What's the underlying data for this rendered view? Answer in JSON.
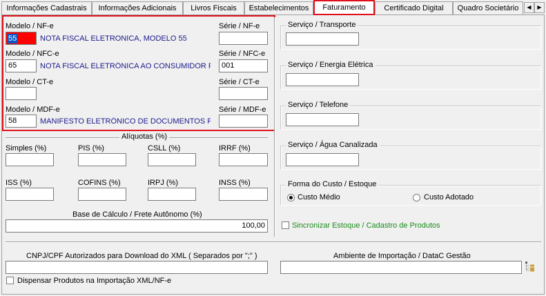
{
  "tabs": [
    {
      "label": "Informações Cadastrais"
    },
    {
      "label": "Informações Adicionais"
    },
    {
      "label": "Livros Fiscais"
    },
    {
      "label": "Estabelecimentos"
    },
    {
      "label": "Faturamento"
    },
    {
      "label": "Certificado Digital"
    },
    {
      "label": "Quadro Societário"
    }
  ],
  "tab_scroll": {
    "left": "◀",
    "right": "▶"
  },
  "modelos": {
    "nfe": {
      "label": "Modelo / NF-e",
      "value": "55",
      "description": "NOTA FISCAL ELETRONICA, MODELO 55",
      "serie_label": "Série / NF-e",
      "serie_value": ""
    },
    "nfce": {
      "label": "Modelo / NFC-e",
      "value": "65",
      "description": "NOTA FISCAL ELETRÔNICA AO CONSUMIDOR FINA",
      "serie_label": "Série / NFC-e",
      "serie_value": "001"
    },
    "cte": {
      "label": "Modelo / CT-e",
      "value": "",
      "description": "",
      "serie_label": "Série / CT-e",
      "serie_value": ""
    },
    "mdfe": {
      "label": "Modelo / MDF-e",
      "value": "58",
      "description": "MANIFESTO ELETRÔNICO DE DOCUMENTOS FISCA",
      "serie_label": "Série / MDF-e",
      "serie_value": ""
    }
  },
  "aliquotas": {
    "title": "Alíquotas (%)",
    "fields": [
      {
        "label": "Simples (%)",
        "value": ""
      },
      {
        "label": "PIS (%)",
        "value": ""
      },
      {
        "label": "CSLL (%)",
        "value": ""
      },
      {
        "label": "IRRF (%)",
        "value": ""
      },
      {
        "label": "ISS (%)",
        "value": ""
      },
      {
        "label": "COFINS (%)",
        "value": ""
      },
      {
        "label": "IRPJ (%)",
        "value": ""
      },
      {
        "label": "INSS (%)",
        "value": ""
      }
    ],
    "base_label": "Base de Cálculo / Frete Autônomo (%)",
    "base_value": "100,00"
  },
  "servicos": [
    {
      "label": "Serviço / Transporte",
      "value": ""
    },
    {
      "label": "Serviço / Energia Elétrica",
      "value": ""
    },
    {
      "label": "Serviço / Telefone",
      "value": ""
    },
    {
      "label": "Serviço / Água Canalizada",
      "value": ""
    }
  ],
  "forma_custo": {
    "title": "Forma do Custo / Estoque",
    "options": [
      {
        "label": "Custo Médio",
        "selected": true
      },
      {
        "label": "Custo Adotado",
        "selected": false
      }
    ]
  },
  "sincronizar": {
    "label": "Sincronizar Estoque / Cadastro de Produtos",
    "checked": false
  },
  "cnpj_xml": {
    "label": "CNPJ/CPF Autorizados para Download do XML  ( Separados por \";\" )",
    "value": ""
  },
  "ambiente": {
    "label": "Ambiente de Importação / DataC Gestão",
    "value": ""
  },
  "dispensar": {
    "label": "Dispensar Produtos na Importação XML/NF-e",
    "checked": false
  }
}
